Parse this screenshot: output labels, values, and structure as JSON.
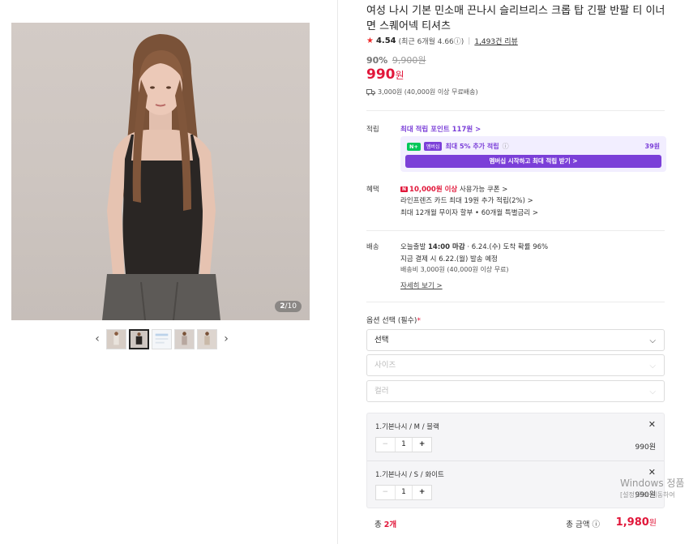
{
  "gallery": {
    "counter_current": "2",
    "counter_total": "/10",
    "prev_icon": "chevron-left-icon",
    "next_icon": "chevron-right-icon"
  },
  "product": {
    "title": "여성 나시 기본 민소매 끈나시 슬리브리스 크롭 탑 긴팔 반팔 티 이너면 스퀘어넥 티셔츠",
    "rating": "4.54",
    "rating_recent": "(최근 6개월 4.66ⓘ)",
    "review_count": "1,493건 리뷰",
    "discount_pct": "90%",
    "original_price": "9,900원",
    "price": "990",
    "price_unit": "원",
    "shipping": "3,000원 (40,000원 이상 무료배송)"
  },
  "points": {
    "label": "적립",
    "max_points": "최대 적립 포인트 117원 >",
    "np_badge": "N+",
    "np_badge2": "멤버십",
    "np_text": "최대 5% 추가 적립",
    "np_info": "ⓘ",
    "np_points": "39원",
    "np_button": "멤버십 시작하고 최대 적립 받기 >"
  },
  "benefits": {
    "label": "혜택",
    "coupon_badge": "N",
    "coupon_amount": "10,000원 이상",
    "coupon_text": " 사용가능 쿠폰 >",
    "card_text": "라인프렌즈 카드 최대 19원 추가 적립(2%) >",
    "installment_text": "최대 12개월 무이자 할부 • 60개월 특별금리 >"
  },
  "delivery": {
    "label": "배송",
    "line1_a": "오늘출발 ",
    "line1_b": "14:00 마감",
    "line1_c": " · 6.24.(수) 도착 확률 96%",
    "line2": "지금 결제 시 6.22.(월) 발송 예정",
    "line3": "배송비 3,000원 (40,000원 이상 무료)",
    "detail_link": "자세히 보기 >"
  },
  "options": {
    "title": "옵션 선택 (필수)",
    "required_mark": "*",
    "select_main": "선택",
    "select_size": "사이즈",
    "select_color": "컬러"
  },
  "cart": {
    "items": [
      {
        "name": "1.기본나시 / M / 블랙",
        "qty": "1",
        "price": "990원"
      },
      {
        "name": "1.기본나시 / S / 화이트",
        "qty": "1",
        "price": "990원"
      }
    ]
  },
  "total": {
    "count_label": "총 ",
    "count": "2개",
    "amount_label": "총 금액 ⓘ",
    "amount": "1,980",
    "amount_unit": "원"
  },
  "watermark": {
    "line1": "Windows 정품",
    "line2": "[설정]으로 이동하여"
  },
  "colors": {
    "accent_red": "#e1173a",
    "accent_purple": "#7b3fd8",
    "naver_green": "#03c75a"
  }
}
